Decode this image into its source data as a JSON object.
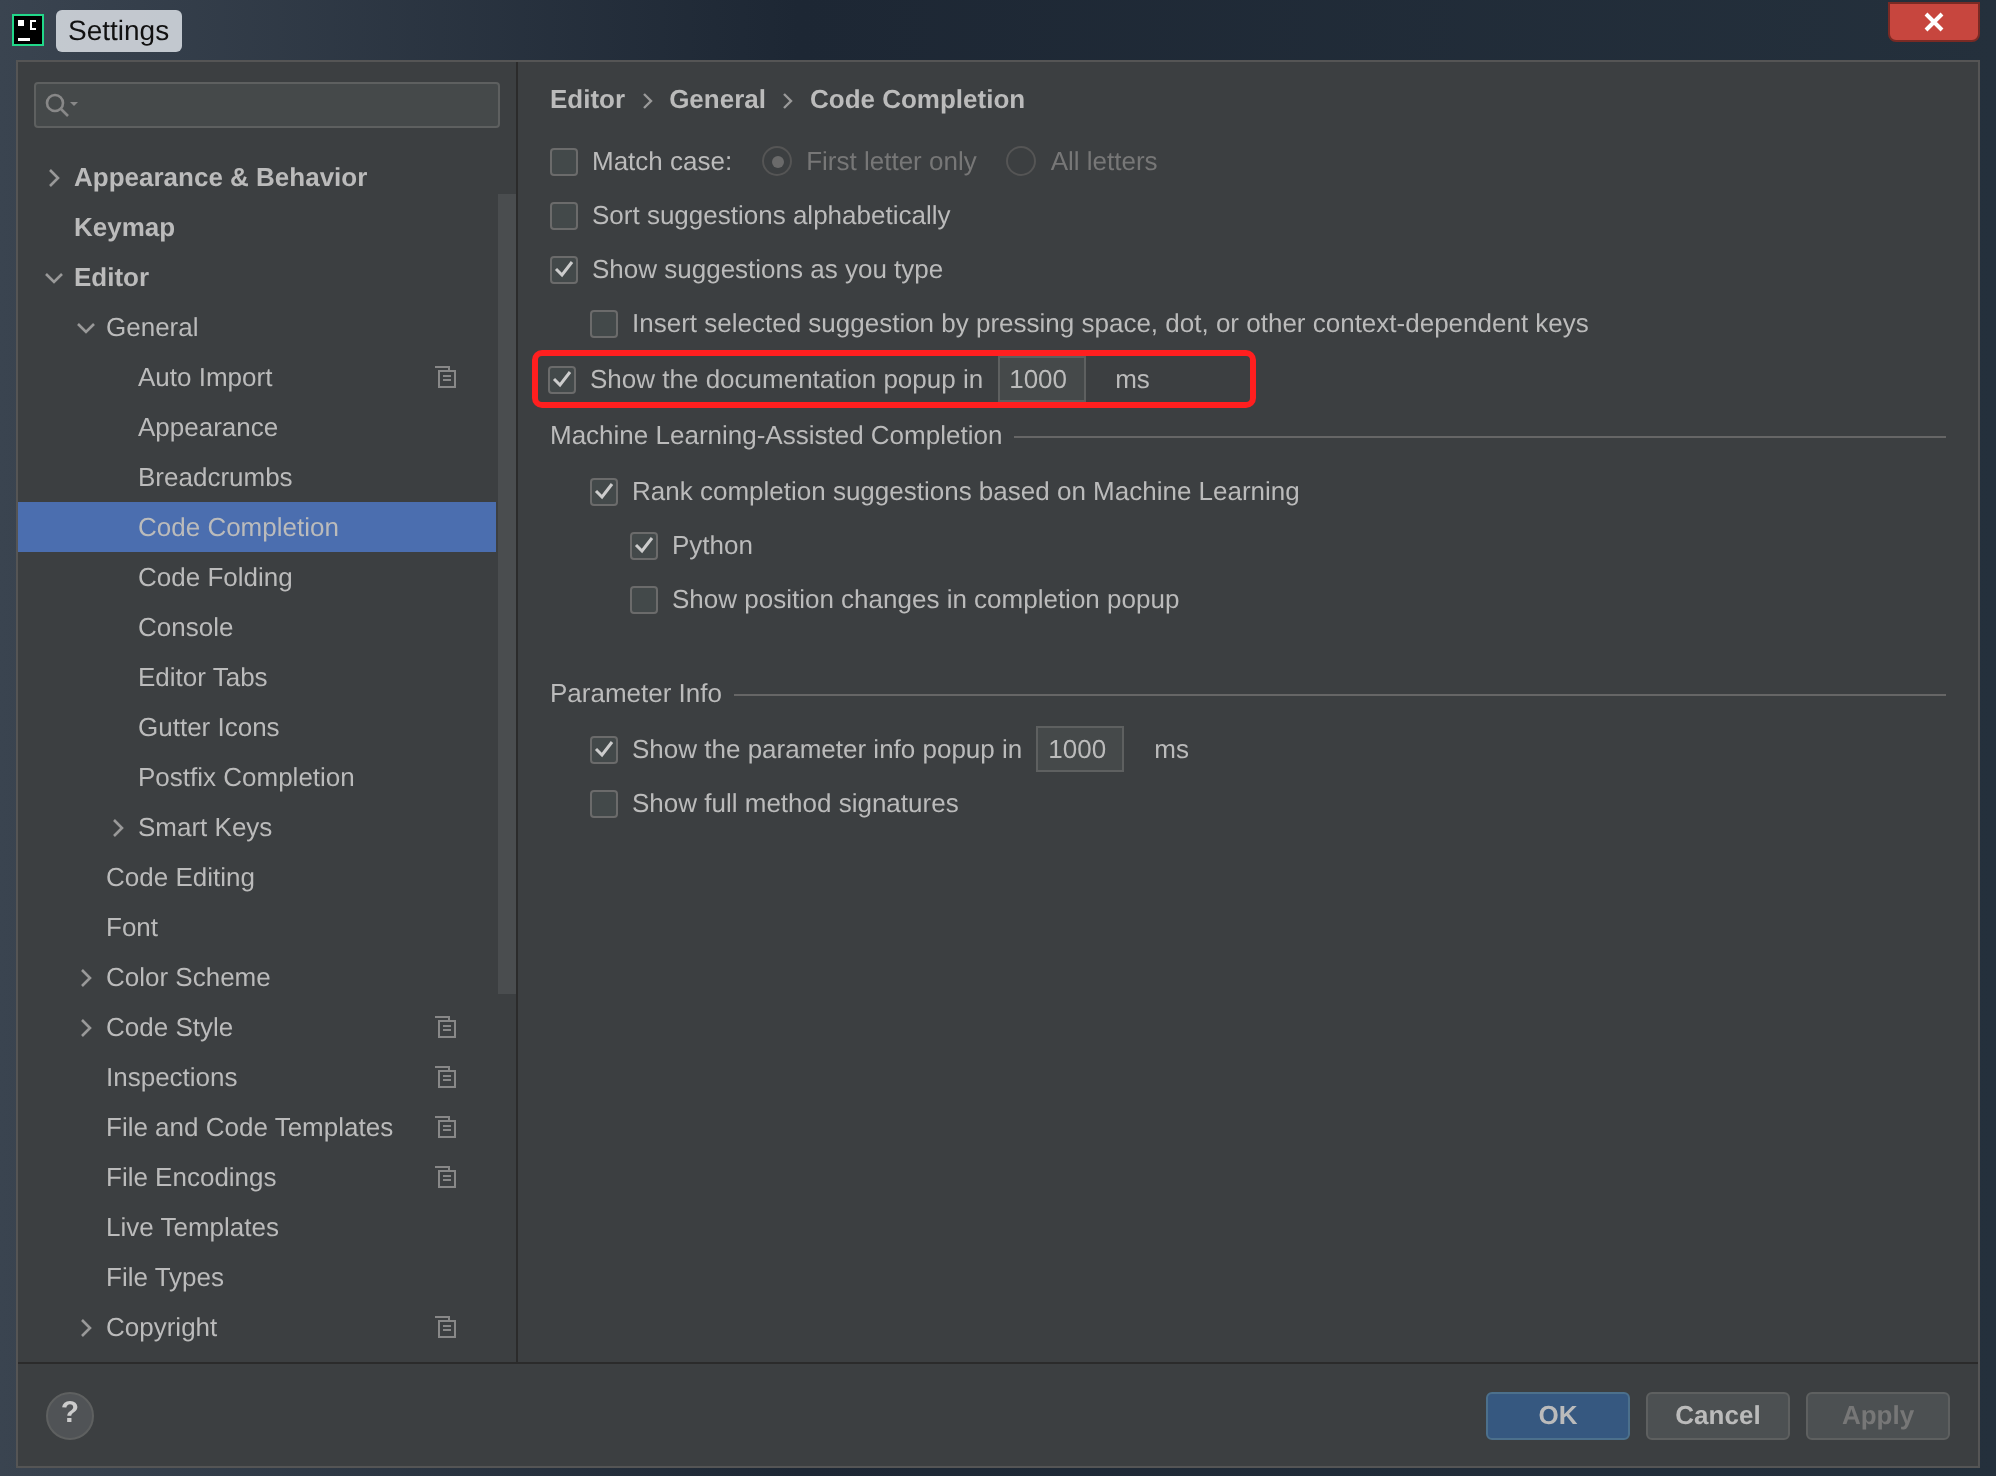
{
  "window": {
    "title": "Settings"
  },
  "help": {
    "label": "?"
  },
  "sidebar": {
    "items": [
      {
        "label": "Appearance & Behavior",
        "expanded": false,
        "selected": false,
        "project_icon": false
      },
      {
        "label": "Keymap",
        "selected": false,
        "project_icon": false
      },
      {
        "label": "Editor",
        "expanded": true,
        "selected": false,
        "project_icon": false,
        "children": [
          {
            "label": "General",
            "expanded": true,
            "selected": false,
            "project_icon": false,
            "children": [
              {
                "label": "Auto Import",
                "selected": false,
                "project_icon": true
              },
              {
                "label": "Appearance",
                "selected": false,
                "project_icon": false
              },
              {
                "label": "Breadcrumbs",
                "selected": false,
                "project_icon": false
              },
              {
                "label": "Code Completion",
                "selected": true,
                "project_icon": false
              },
              {
                "label": "Code Folding",
                "selected": false,
                "project_icon": false
              },
              {
                "label": "Console",
                "selected": false,
                "project_icon": false
              },
              {
                "label": "Editor Tabs",
                "selected": false,
                "project_icon": false
              },
              {
                "label": "Gutter Icons",
                "selected": false,
                "project_icon": false
              },
              {
                "label": "Postfix Completion",
                "selected": false,
                "project_icon": false
              },
              {
                "label": "Smart Keys",
                "expanded": false,
                "selected": false,
                "project_icon": false
              }
            ]
          },
          {
            "label": "Code Editing",
            "selected": false,
            "project_icon": false
          },
          {
            "label": "Font",
            "selected": false,
            "project_icon": false
          },
          {
            "label": "Color Scheme",
            "expanded": false,
            "selected": false,
            "project_icon": false
          },
          {
            "label": "Code Style",
            "expanded": false,
            "selected": false,
            "project_icon": true
          },
          {
            "label": "Inspections",
            "selected": false,
            "project_icon": true
          },
          {
            "label": "File and Code Templates",
            "selected": false,
            "project_icon": true
          },
          {
            "label": "File Encodings",
            "selected": false,
            "project_icon": true
          },
          {
            "label": "Live Templates",
            "selected": false,
            "project_icon": false
          },
          {
            "label": "File Types",
            "selected": false,
            "project_icon": false
          },
          {
            "label": "Copyright",
            "expanded": false,
            "selected": false,
            "project_icon": true
          }
        ]
      }
    ]
  },
  "breadcrumb": [
    "Editor",
    "General",
    "Code Completion"
  ],
  "options": [
    {
      "kind": "checkbox",
      "label": "Match case:",
      "checked": false,
      "radios": [
        {
          "label": "First letter only",
          "selected": true,
          "disabled": true
        },
        {
          "label": "All letters",
          "selected": false,
          "disabled": true
        }
      ]
    },
    {
      "kind": "checkbox",
      "label": "Sort suggestions alphabetically",
      "checked": false
    },
    {
      "kind": "checkbox",
      "label": "Show suggestions as you type",
      "checked": true,
      "children": [
        {
          "kind": "checkbox",
          "label": "Insert selected suggestion by pressing space, dot, or other context-dependent keys",
          "checked": false
        }
      ]
    },
    {
      "kind": "number",
      "label": "Show the documentation popup in",
      "checked": true,
      "value": "1000",
      "unit": "ms",
      "highlighted": true
    },
    {
      "kind": "section",
      "label": "Machine Learning-Assisted Completion",
      "children": [
        {
          "kind": "checkbox",
          "label": "Rank completion suggestions based on Machine Learning",
          "checked": true,
          "children": [
            {
              "kind": "checkbox",
              "label": "Python",
              "checked": true
            },
            {
              "kind": "checkbox",
              "label": "Show position changes in completion popup",
              "checked": false
            }
          ]
        }
      ]
    },
    {
      "kind": "section",
      "label": "Parameter Info",
      "children": [
        {
          "kind": "number",
          "label": "Show the parameter info popup in",
          "checked": true,
          "value": "1000",
          "unit": "ms",
          "highlighted": false
        },
        {
          "kind": "checkbox",
          "label": "Show full method signatures",
          "checked": false
        }
      ]
    }
  ],
  "buttons": [
    {
      "label": "OK",
      "primary": true,
      "disabled": false
    },
    {
      "label": "Cancel",
      "primary": false,
      "disabled": false
    },
    {
      "label": "Apply",
      "primary": false,
      "disabled": true
    }
  ]
}
